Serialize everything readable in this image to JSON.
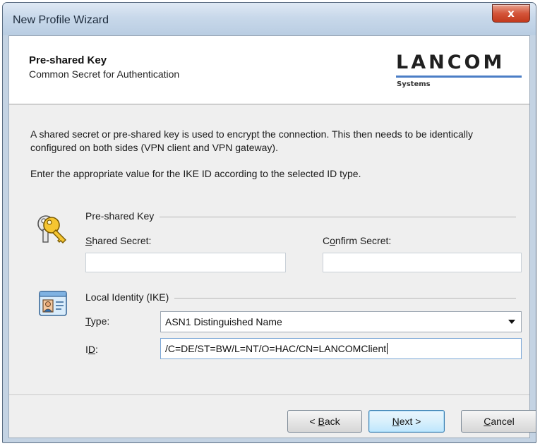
{
  "window": {
    "title": "New Profile Wizard",
    "close_glyph": "x"
  },
  "header": {
    "title": "Pre-shared Key",
    "subtitle": "Common Secret for Authentication",
    "logo": {
      "main": "LANCOM",
      "sub": "Systems",
      "accent_color": "#4b7ec6"
    }
  },
  "body": {
    "description": "A shared secret or pre-shared key is used to encrypt the connection. This then needs to be identically configured on both sides (VPN client and VPN gateway).",
    "instruction": "Enter the appropriate value for the IKE ID according to the selected ID type."
  },
  "psk_group": {
    "label": "Pre-shared Key",
    "icon": "keys-icon",
    "shared_secret": {
      "label_mnemonic": "S",
      "label_rest": "hared Secret:",
      "value": ""
    },
    "confirm_secret": {
      "label_pre": "C",
      "label_mnemonic": "o",
      "label_rest": "nfirm Secret:",
      "value": ""
    }
  },
  "identity_group": {
    "label": "Local Identity (IKE)",
    "icon": "id-card-icon",
    "type": {
      "label_mnemonic": "T",
      "label_rest": "ype:",
      "selected": "ASN1 Distinguished Name"
    },
    "id": {
      "label_pre": "I",
      "label_mnemonic": "D",
      "label_rest": ":",
      "value": "/C=DE/ST=BW/L=NT/O=HAC/CN=LANCOMClient"
    }
  },
  "buttons": {
    "back": {
      "pre": "< ",
      "mnemonic": "B",
      "rest": "ack"
    },
    "next": {
      "pre": "",
      "mnemonic": "N",
      "rest": "ext >"
    },
    "cancel": {
      "pre": "",
      "mnemonic": "C",
      "rest": "ancel"
    }
  }
}
